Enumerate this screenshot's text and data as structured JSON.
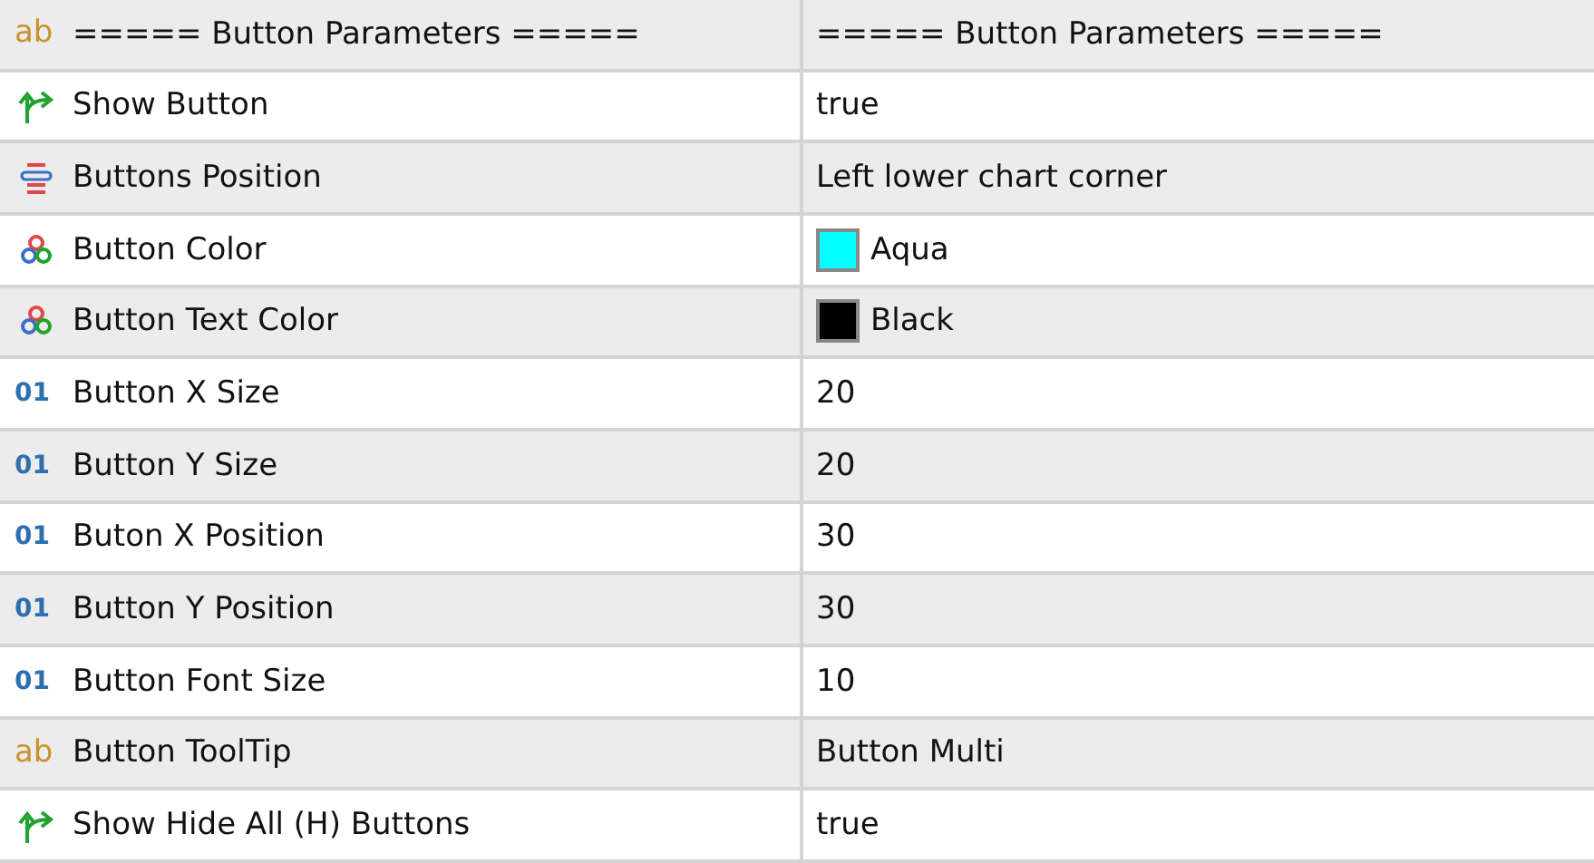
{
  "rows": [
    {
      "kind": "text",
      "icon_text": "ab",
      "name": "===== Button Parameters =====",
      "value": "===== Button Parameters ====="
    },
    {
      "kind": "bool",
      "name": "Show Button",
      "value": "true"
    },
    {
      "kind": "enum",
      "name": "Buttons Position",
      "value": "Left lower chart corner"
    },
    {
      "kind": "color",
      "name": "Button Color",
      "value": "Aqua",
      "color": "#00ffff"
    },
    {
      "kind": "color",
      "name": "Button Text Color",
      "value": "Black",
      "color": "#000000"
    },
    {
      "kind": "int",
      "icon_text": "01",
      "name": "Button X Size",
      "value": "20"
    },
    {
      "kind": "int",
      "icon_text": "01",
      "name": "Button Y Size",
      "value": "20"
    },
    {
      "kind": "int",
      "icon_text": "01",
      "name": "Buton X Position",
      "value": "30"
    },
    {
      "kind": "int",
      "icon_text": "01",
      "name": "Button Y Position",
      "value": "30"
    },
    {
      "kind": "int",
      "icon_text": "01",
      "name": "Button Font Size",
      "value": "10"
    },
    {
      "kind": "text",
      "icon_text": "ab",
      "name": "Button ToolTip",
      "value": "Button Multi"
    },
    {
      "kind": "bool",
      "name": "Show Hide All (H) Buttons",
      "value": "true"
    }
  ]
}
